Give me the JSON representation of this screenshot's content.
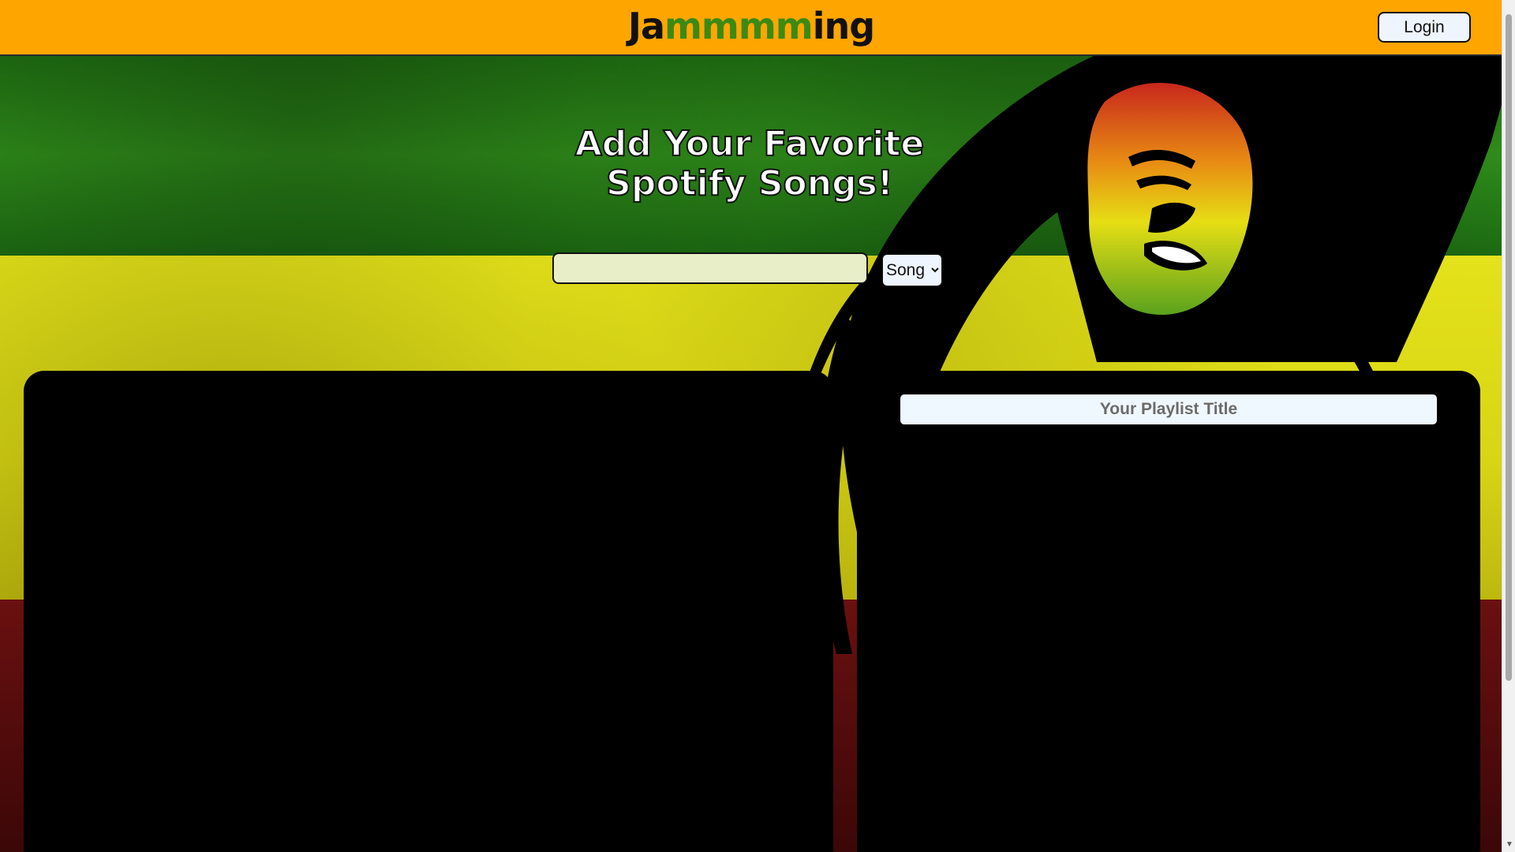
{
  "header": {
    "logo_prefix": "Ja",
    "logo_middle": "mmmm",
    "logo_suffix": "ing",
    "login_label": "Login",
    "background_color": "#ffa500"
  },
  "hero": {
    "title_line1": "Add Your Favorite",
    "title_line2": "Spotify Songs!"
  },
  "search": {
    "value": "",
    "placeholder": "",
    "type_selected": "Song"
  },
  "playlist": {
    "title_placeholder": "Your Playlist Title"
  },
  "theme": {
    "green": "#2f8d1a",
    "yellow": "#e4e21a",
    "red": "#6a1010",
    "panel": "#000000"
  },
  "icons": [
    "chevron-down-icon"
  ]
}
